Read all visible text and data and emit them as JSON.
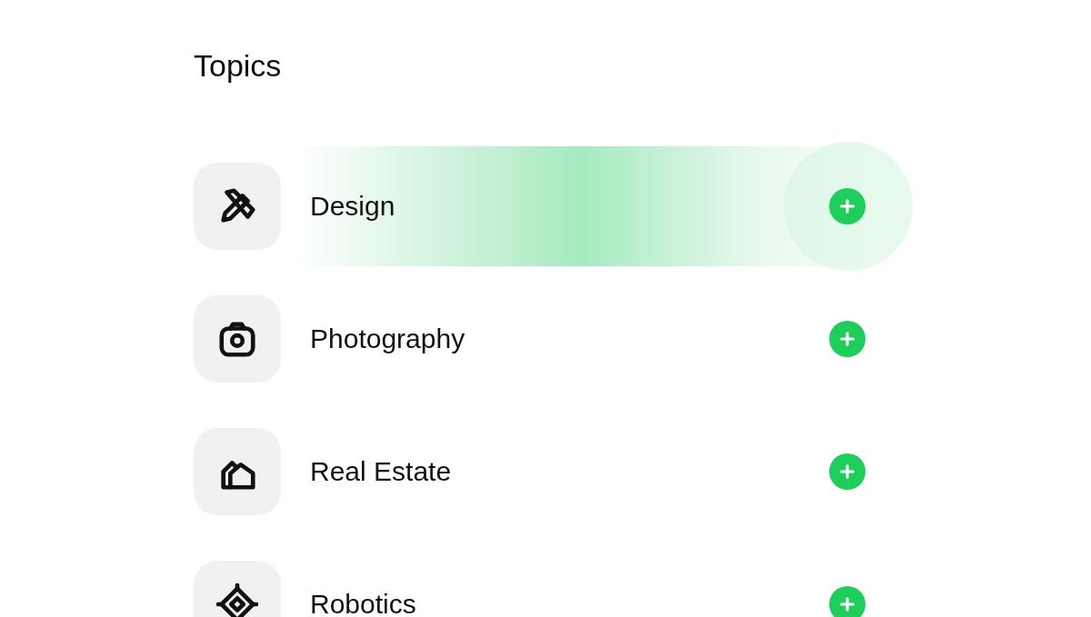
{
  "title": "Topics",
  "topics": [
    {
      "kind": "design",
      "label": "Design",
      "highlighted": true
    },
    {
      "kind": "photography",
      "label": "Photography",
      "highlighted": false
    },
    {
      "kind": "real-estate",
      "label": "Real Estate",
      "highlighted": false
    },
    {
      "kind": "robotics",
      "label": "Robotics",
      "highlighted": false
    }
  ]
}
